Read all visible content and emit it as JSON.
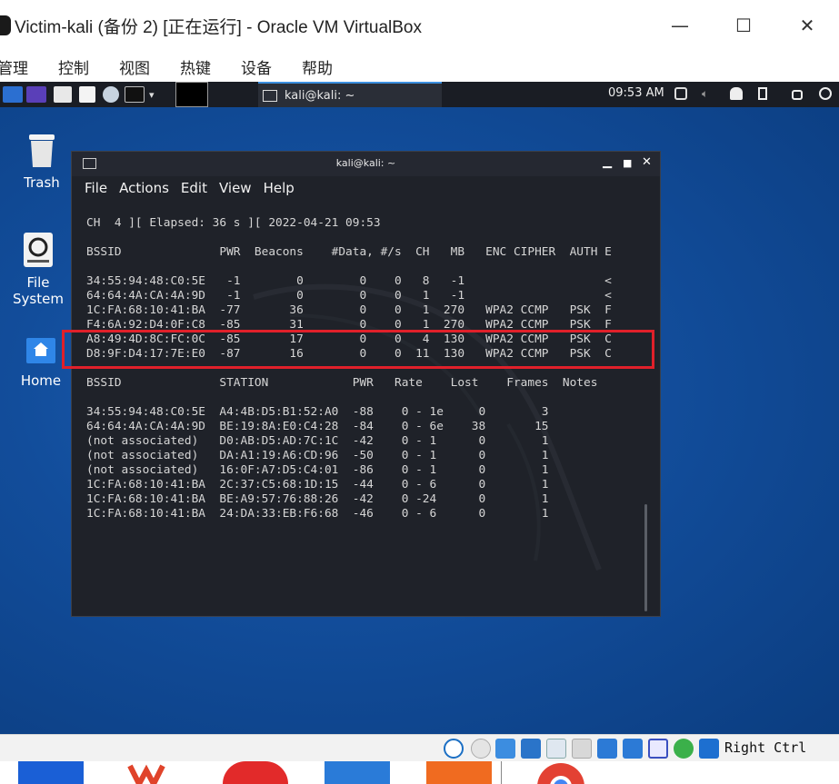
{
  "window": {
    "title": "Victim-kali (备份 2) [正在运行] - Oracle VM VirtualBox",
    "minimize": "—",
    "maximize": "☐",
    "close": "✕"
  },
  "vbox_menu": [
    "管理",
    "控制",
    "视图",
    "热键",
    "设备",
    "帮助"
  ],
  "panel": {
    "task_label": "kali@kali: ~",
    "clock": "09:53 AM"
  },
  "desktop_icons": [
    {
      "label": "Trash",
      "icon": "trash-icon"
    },
    {
      "label": "File System",
      "icon": "drive-icon"
    },
    {
      "label": "Home",
      "icon": "home-folder-icon"
    }
  ],
  "terminal": {
    "title": "kali@kali: ~",
    "menu": [
      "File",
      "Actions",
      "Edit",
      "View",
      "Help"
    ],
    "lines": [
      "CH  4 ][ Elapsed: 36 s ][ 2022-04-21 09:53",
      "",
      "BSSID              PWR  Beacons    #Data, #/s  CH   MB   ENC CIPHER  AUTH E",
      "",
      "34:55:94:48:C0:5E   -1        0        0    0   8   -1                    <",
      "64:64:4A:CA:4A:9D   -1        0        0    0   1   -1                    <",
      "1C:FA:68:10:41:BA  -77       36        0    0   1  270   WPA2 CCMP   PSK  F",
      "F4:6A:92:D4:0F:C8  -85       31        0    0   1  270   WPA2 CCMP   PSK  F",
      "A8:49:4D:8C:FC:0C  -85       17        0    0   4  130   WPA2 CCMP   PSK  C",
      "D8:9F:D4:17:7E:E0  -87       16        0    0  11  130   WPA2 CCMP   PSK  C",
      "",
      "BSSID              STATION            PWR   Rate    Lost    Frames  Notes",
      "",
      "34:55:94:48:C0:5E  A4:4B:D5:B1:52:A0  -88    0 - 1e     0        3",
      "64:64:4A:CA:4A:9D  BE:19:8A:E0:C4:28  -84    0 - 6e    38       15",
      "(not associated)   D0:AB:D5:AD:7C:1C  -42    0 - 1      0        1",
      "(not associated)   DA:A1:19:A6:CD:96  -50    0 - 1      0        1",
      "(not associated)   16:0F:A7:D5:C4:01  -86    0 - 1      0        1",
      "1C:FA:68:10:41:BA  2C:37:C5:68:1D:15  -44    0 - 6      0        1",
      "1C:FA:68:10:41:BA  BE:A9:57:76:88:26  -42    0 -24      0        1",
      "1C:FA:68:10:41:BA  24:DA:33:EB:F6:68  -46    0 - 6      0        1"
    ]
  },
  "status_bar": {
    "host_key": "Right Ctrl"
  },
  "colors": {
    "desktop": "#124d9b",
    "terminal_bg": "#1f2229",
    "highlight": "#e0202a",
    "panel": "#1a1d24"
  }
}
